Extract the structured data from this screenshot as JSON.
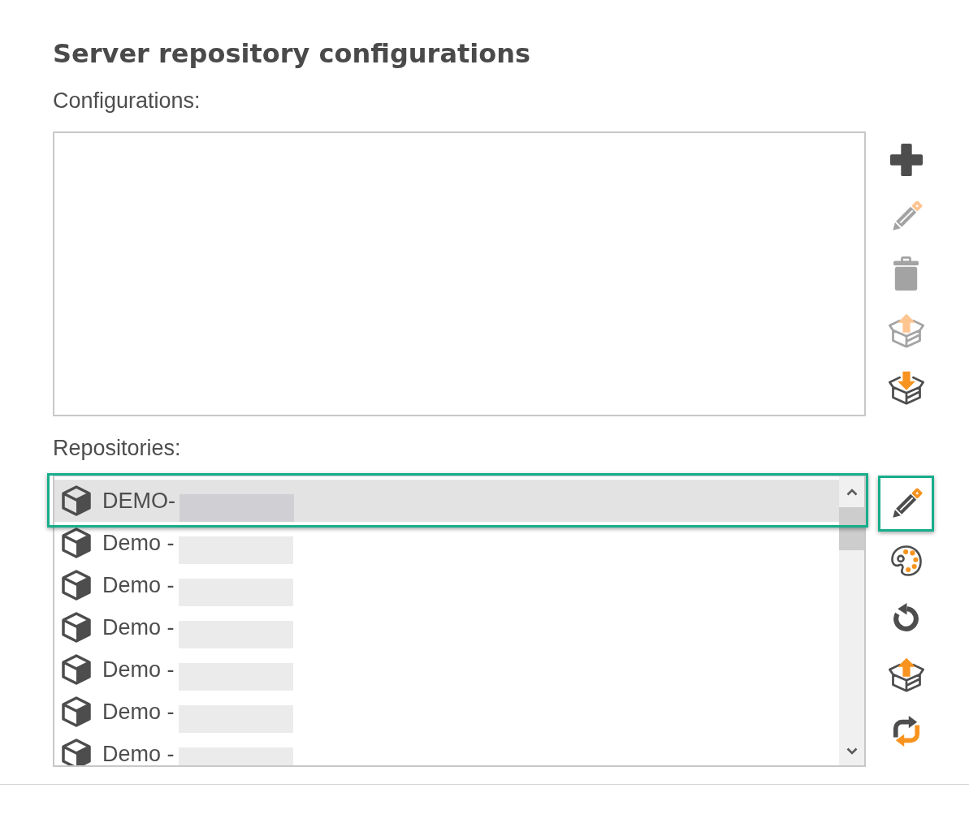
{
  "page": {
    "title": "Server repository configurations"
  },
  "configurations": {
    "label": "Configurations:",
    "actions": [
      {
        "kind": "add",
        "disabled": false
      },
      {
        "kind": "edit",
        "disabled": true
      },
      {
        "kind": "delete",
        "disabled": true
      },
      {
        "kind": "export",
        "disabled": true
      },
      {
        "kind": "import",
        "disabled": false
      }
    ]
  },
  "repositories": {
    "label": "Repositories:",
    "items": [
      {
        "label": "DEMO-",
        "redacted": true,
        "selected": true,
        "highlighted": true
      },
      {
        "label": "Demo -",
        "redacted": true,
        "selected": false,
        "highlighted": false
      },
      {
        "label": "Demo -",
        "redacted": true,
        "selected": false,
        "highlighted": false
      },
      {
        "label": "Demo -",
        "redacted": true,
        "selected": false,
        "highlighted": false
      },
      {
        "label": "Demo -",
        "redacted": true,
        "selected": false,
        "highlighted": false
      },
      {
        "label": "Demo -",
        "redacted": true,
        "selected": false,
        "highlighted": false
      },
      {
        "label": "Demo -",
        "redacted": true,
        "selected": false,
        "highlighted": false
      }
    ],
    "actions": [
      {
        "kind": "edit",
        "disabled": false,
        "highlighted": true
      },
      {
        "kind": "palette",
        "disabled": false,
        "highlighted": false
      },
      {
        "kind": "reset",
        "disabled": false,
        "highlighted": false
      },
      {
        "kind": "export",
        "disabled": false,
        "highlighted": false
      },
      {
        "kind": "sync",
        "disabled": false,
        "highlighted": false
      }
    ]
  }
}
